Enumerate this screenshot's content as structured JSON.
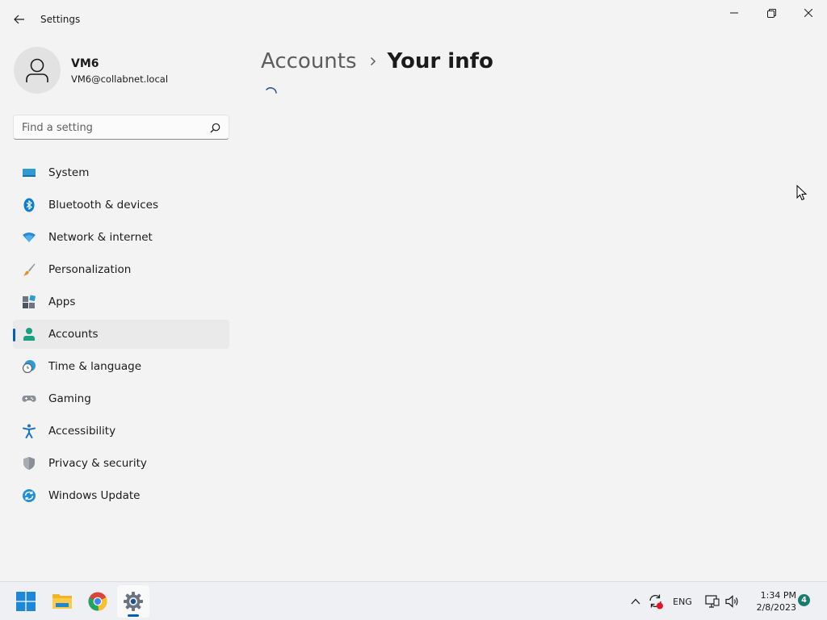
{
  "window": {
    "title": "Settings",
    "controls": [
      "minimize",
      "maximize",
      "close"
    ]
  },
  "profile": {
    "name": "VM6",
    "email": "VM6@collabnet.local"
  },
  "search": {
    "placeholder": "Find a setting",
    "value": ""
  },
  "sidebar": {
    "items": [
      {
        "label": "System",
        "icon": "system-icon",
        "active": false
      },
      {
        "label": "Bluetooth & devices",
        "icon": "bluetooth-icon",
        "active": false
      },
      {
        "label": "Network & internet",
        "icon": "wifi-icon",
        "active": false
      },
      {
        "label": "Personalization",
        "icon": "paintbrush-icon",
        "active": false
      },
      {
        "label": "Apps",
        "icon": "apps-icon",
        "active": false
      },
      {
        "label": "Accounts",
        "icon": "accounts-icon",
        "active": true
      },
      {
        "label": "Time & language",
        "icon": "clock-globe-icon",
        "active": false
      },
      {
        "label": "Gaming",
        "icon": "gamepad-icon",
        "active": false
      },
      {
        "label": "Accessibility",
        "icon": "accessibility-icon",
        "active": false
      },
      {
        "label": "Privacy & security",
        "icon": "shield-icon",
        "active": false
      },
      {
        "label": "Windows Update",
        "icon": "windows-update-icon",
        "active": false
      }
    ]
  },
  "main": {
    "breadcrumb_parent": "Accounts",
    "breadcrumb_current": "Your info",
    "loading": true
  },
  "taskbar": {
    "apps": [
      {
        "name": "Start",
        "icon": "windows-start-icon"
      },
      {
        "name": "File Explorer",
        "icon": "folder-icon"
      },
      {
        "name": "Google Chrome",
        "icon": "chrome-icon"
      },
      {
        "name": "Settings",
        "icon": "gear-icon",
        "active": true
      }
    ],
    "tray": {
      "language": "ENG",
      "time": "1:34 PM",
      "date": "2/8/2023",
      "notification_count": "4"
    }
  },
  "colors": {
    "accent": "#005fb8",
    "background": "#f3f3f3",
    "notification_badge": "#1a7a6e"
  }
}
